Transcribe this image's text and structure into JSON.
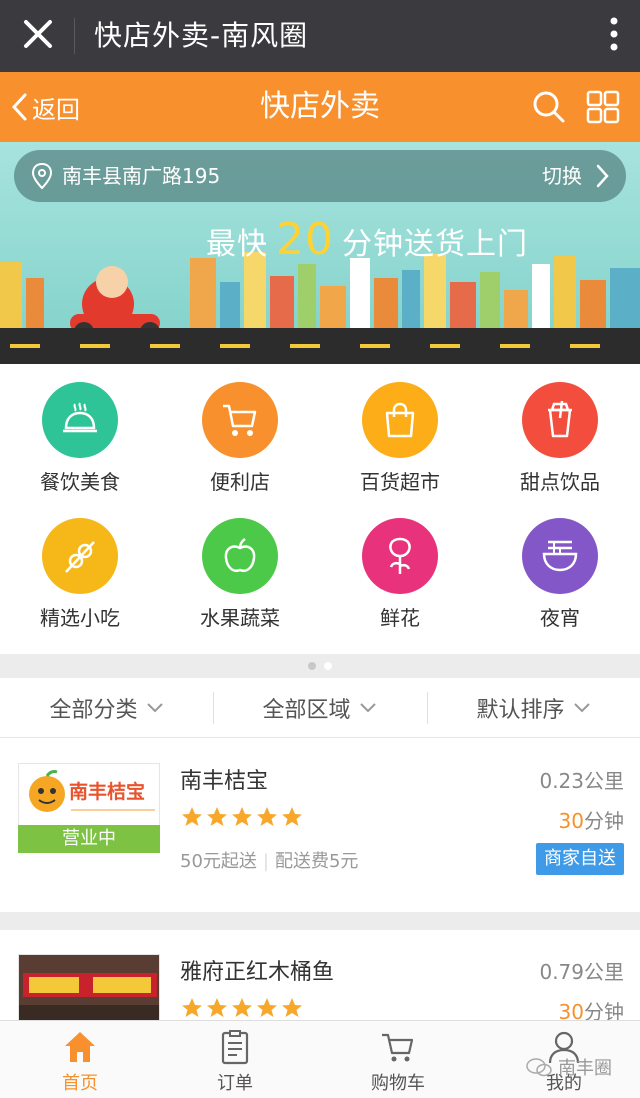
{
  "wechat": {
    "title": "快店外卖-南风圈"
  },
  "header": {
    "back_label": "返回",
    "title": "快店外卖"
  },
  "banner": {
    "address": "南丰县南广路195",
    "switch_label": "切换",
    "slogan_pre": "最快",
    "slogan_num": "20",
    "slogan_post": "分钟送货上门"
  },
  "categories": [
    {
      "label": "餐饮美食",
      "icon": "cloche-icon",
      "color": "#2fc497"
    },
    {
      "label": "便利店",
      "icon": "cart-icon",
      "color": "#f7902d"
    },
    {
      "label": "百货超市",
      "icon": "shopping-bag-icon",
      "color": "#fcad18"
    },
    {
      "label": "甜点饮品",
      "icon": "drink-cup-icon",
      "color": "#f24d3d"
    },
    {
      "label": "精选小吃",
      "icon": "skewer-icon",
      "color": "#f6b818"
    },
    {
      "label": "水果蔬菜",
      "icon": "apple-icon",
      "color": "#4dc94a"
    },
    {
      "label": "鲜花",
      "icon": "rose-icon",
      "color": "#e8327c"
    },
    {
      "label": "夜宵",
      "icon": "noodle-bowl-icon",
      "color": "#8457c8"
    }
  ],
  "filters": {
    "category": "全部分类",
    "region": "全部区域",
    "sort": "默认排序"
  },
  "stores": [
    {
      "name": "南丰桔宝",
      "logo_text": "南丰桔宝",
      "status": "营业中",
      "rating": 5,
      "min_order": "50元起送",
      "delivery_fee": "配送费5元",
      "distance": "0.23公里",
      "time_num": "30",
      "time_unit": "分钟",
      "tag": "商家自送"
    },
    {
      "name": "雅府正红木桶鱼",
      "rating": 5,
      "distance": "0.79公里",
      "time_num": "30",
      "time_unit": "分钟"
    }
  ],
  "tabs": [
    {
      "label": "首页",
      "icon": "home-icon",
      "active": true
    },
    {
      "label": "订单",
      "icon": "order-icon",
      "active": false
    },
    {
      "label": "购物车",
      "icon": "cart-icon",
      "active": false
    },
    {
      "label": "我的",
      "icon": "user-icon",
      "active": false
    }
  ],
  "watermark": "南丰圈",
  "colors": {
    "brand": "#f7902d",
    "wechat_bar": "#3b3b3f",
    "tag_blue": "#3f9be8",
    "open_green": "#7dc242"
  }
}
